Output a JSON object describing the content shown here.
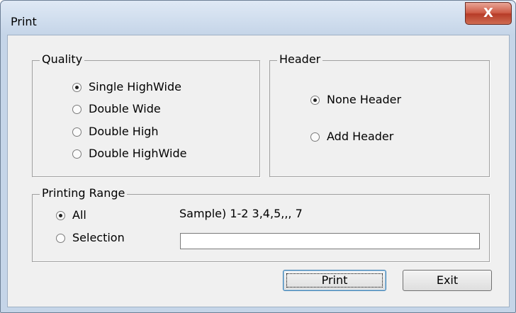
{
  "window": {
    "title": "Print",
    "close_glyph": "X",
    "close_icon": "close-icon"
  },
  "quality": {
    "label": "Quality",
    "options": [
      {
        "label": "Single HighWide",
        "checked": true
      },
      {
        "label": "Double Wide",
        "checked": false
      },
      {
        "label": "Double High",
        "checked": false
      },
      {
        "label": "Double HighWide",
        "checked": false
      }
    ]
  },
  "header": {
    "label": "Header",
    "options": [
      {
        "label": "None Header",
        "checked": true
      },
      {
        "label": "Add Header",
        "checked": false
      }
    ]
  },
  "printing_range": {
    "label": "Printing Range",
    "options": [
      {
        "label": "All",
        "checked": true
      },
      {
        "label": "Selection",
        "checked": false
      }
    ],
    "sample_text": "Sample) 1-2  3,4,5,,,  7",
    "selection_value": ""
  },
  "buttons": {
    "print_label": "Print",
    "exit_label": "Exit"
  }
}
